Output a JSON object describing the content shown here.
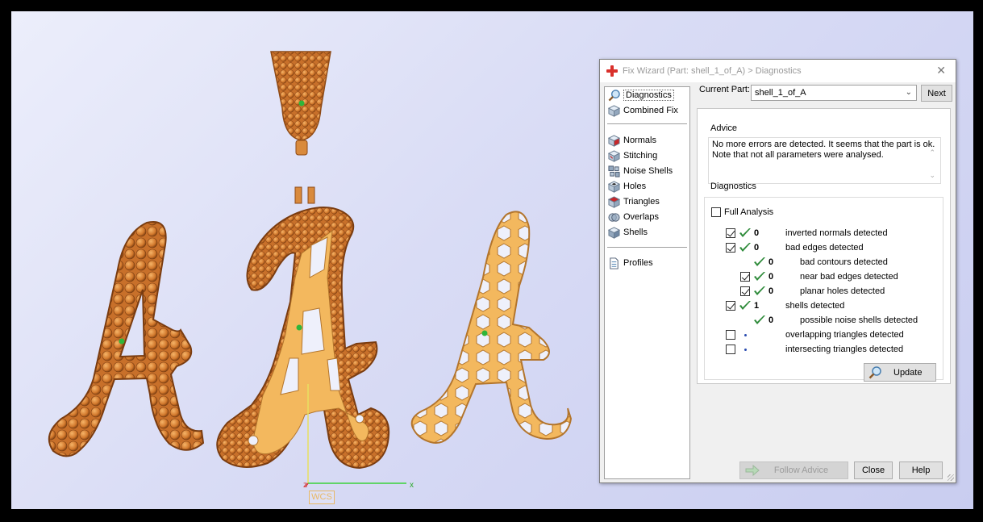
{
  "viewport": {
    "wcs_label": "WCS",
    "axis_x": "x",
    "axis_z": "z"
  },
  "dialog": {
    "title": "Fix Wizard (Part: shell_1_of_A) > Diagnostics",
    "close_glyph": "✕",
    "nav": {
      "items": [
        {
          "label": "Diagnostics",
          "icon": "magnifier-icon",
          "selected": true
        },
        {
          "label": "Combined Fix",
          "icon": "cube-icon"
        },
        {
          "label": "Normals",
          "icon": "normals-cube-icon"
        },
        {
          "label": "Stitching",
          "icon": "stitching-cube-icon"
        },
        {
          "label": "Noise Shells",
          "icon": "noise-shells-icon"
        },
        {
          "label": "Holes",
          "icon": "holes-cube-icon"
        },
        {
          "label": "Triangles",
          "icon": "triangles-cube-icon"
        },
        {
          "label": "Overlaps",
          "icon": "overlaps-icon"
        },
        {
          "label": "Shells",
          "icon": "shells-cube-icon"
        },
        {
          "label": "Profiles",
          "icon": "document-icon"
        }
      ]
    },
    "current_part_label": "Current Part:",
    "current_part_value": "shell_1_of_A",
    "next_button": "Next",
    "advice_label": "Advice",
    "advice_text_1": "No more errors are detected. It seems that the part is ok.",
    "advice_text_2": "Note that not all parameters were analysed.",
    "diagnostics_label": "Diagnostics",
    "full_analysis_label": "Full Analysis",
    "rows": [
      {
        "checked": true,
        "has_checkbox": true,
        "status": "ok",
        "value": "0",
        "label": "inverted normals detected",
        "indent": 0
      },
      {
        "checked": true,
        "has_checkbox": true,
        "status": "ok",
        "value": "0",
        "label": "bad edges detected",
        "indent": 0
      },
      {
        "checked": false,
        "has_checkbox": false,
        "status": "ok",
        "value": "0",
        "label": "bad contours detected",
        "indent": 1
      },
      {
        "checked": true,
        "has_checkbox": true,
        "status": "ok",
        "value": "0",
        "label": "near bad edges detected",
        "indent": 1
      },
      {
        "checked": true,
        "has_checkbox": true,
        "status": "ok",
        "value": "0",
        "label": "planar holes detected",
        "indent": 1
      },
      {
        "checked": true,
        "has_checkbox": true,
        "status": "ok",
        "value": "1",
        "label": "shells detected",
        "indent": 0
      },
      {
        "checked": false,
        "has_checkbox": false,
        "status": "ok",
        "value": "0",
        "label": "possible noise shells detected",
        "indent": 1
      },
      {
        "checked": false,
        "has_checkbox": true,
        "status": "unknown",
        "value": "",
        "label": "overlapping triangles detected",
        "indent": 0
      },
      {
        "checked": false,
        "has_checkbox": true,
        "status": "unknown",
        "value": "",
        "label": "intersecting triangles detected",
        "indent": 0
      }
    ],
    "update_button": "Update",
    "follow_advice_button": "Follow Advice",
    "close_button": "Close",
    "help_button": "Help",
    "colors": {
      "ok_check": "#2e8b3a",
      "title_icon": "#d9302b",
      "model": "#e8a24a"
    }
  }
}
